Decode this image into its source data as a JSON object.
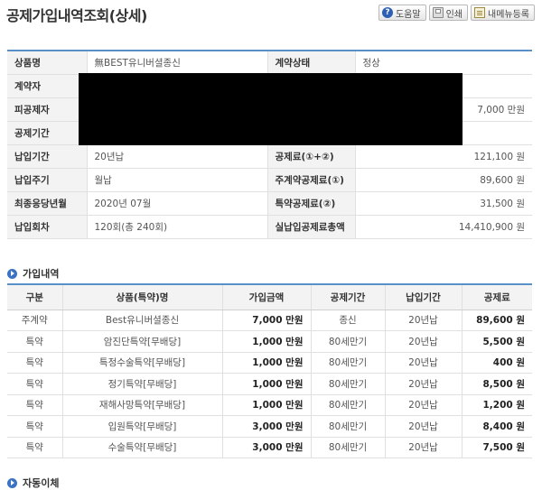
{
  "header": {
    "title": "공제가입내역조회(상세)",
    "buttons": [
      {
        "label": "도움말",
        "icon": "help-icon"
      },
      {
        "label": "인쇄",
        "icon": "print-icon"
      },
      {
        "label": "내메뉴등록",
        "icon": "bookmark-icon"
      }
    ]
  },
  "detail": {
    "product_label": "상품명",
    "product_value": "無BEST유니버셜종신",
    "status_label": "계약상태",
    "status_value": "정상",
    "contractor_label": "계약자",
    "insured_label": "피공제자",
    "insured_amount": "7,000 만원",
    "period_label": "공제기간",
    "pay_period_label": "납입기간",
    "pay_period_value": "20년납",
    "premium_total_label": "공제료(①+②)",
    "premium_total_value": "121,100 원",
    "pay_cycle_label": "납입주기",
    "pay_cycle_value": "월납",
    "main_premium_label": "주계약공제료(①)",
    "main_premium_value": "89,600 원",
    "last_due_label": "최종응당년월",
    "last_due_value": "2020년 07월",
    "rider_premium_label": "특약공제료(②)",
    "rider_premium_value": "31,500 원",
    "pay_count_label": "납입회차",
    "pay_count_value": "120회(총 240회)",
    "paid_total_label": "실납입공제료총액",
    "paid_total_value": "14,410,900 원"
  },
  "join_section": {
    "title": "가입내역",
    "columns": [
      "구분",
      "상품(특약)명",
      "가입금액",
      "공제기간",
      "납입기간",
      "공제료"
    ],
    "rows": [
      {
        "type": "주계약",
        "name": "Best유니버셜종신",
        "amount": "7,000 만원",
        "period": "종신",
        "pay": "20년납",
        "premium": "89,600 원"
      },
      {
        "type": "특약",
        "name": "암진단특약[무배당]",
        "amount": "1,000 만원",
        "period": "80세만기",
        "pay": "20년납",
        "premium": "5,500 원"
      },
      {
        "type": "특약",
        "name": "특정수술특약[무배당]",
        "amount": "1,000 만원",
        "period": "80세만기",
        "pay": "20년납",
        "premium": "400 원"
      },
      {
        "type": "특약",
        "name": "정기특약[무배당]",
        "amount": "1,000 만원",
        "period": "80세만기",
        "pay": "20년납",
        "premium": "8,500 원"
      },
      {
        "type": "특약",
        "name": "재해사망특약[무배당]",
        "amount": "1,000 만원",
        "period": "80세만기",
        "pay": "20년납",
        "premium": "1,200 원"
      },
      {
        "type": "특약",
        "name": "입원특약[무배당]",
        "amount": "3,000 만원",
        "period": "80세만기",
        "pay": "20년납",
        "premium": "8,400 원"
      },
      {
        "type": "특약",
        "name": "수술특약[무배당]",
        "amount": "3,000 만원",
        "period": "80세만기",
        "pay": "20년납",
        "premium": "7,500 원"
      }
    ]
  },
  "auto_transfer_section": {
    "title": "자동이체"
  }
}
